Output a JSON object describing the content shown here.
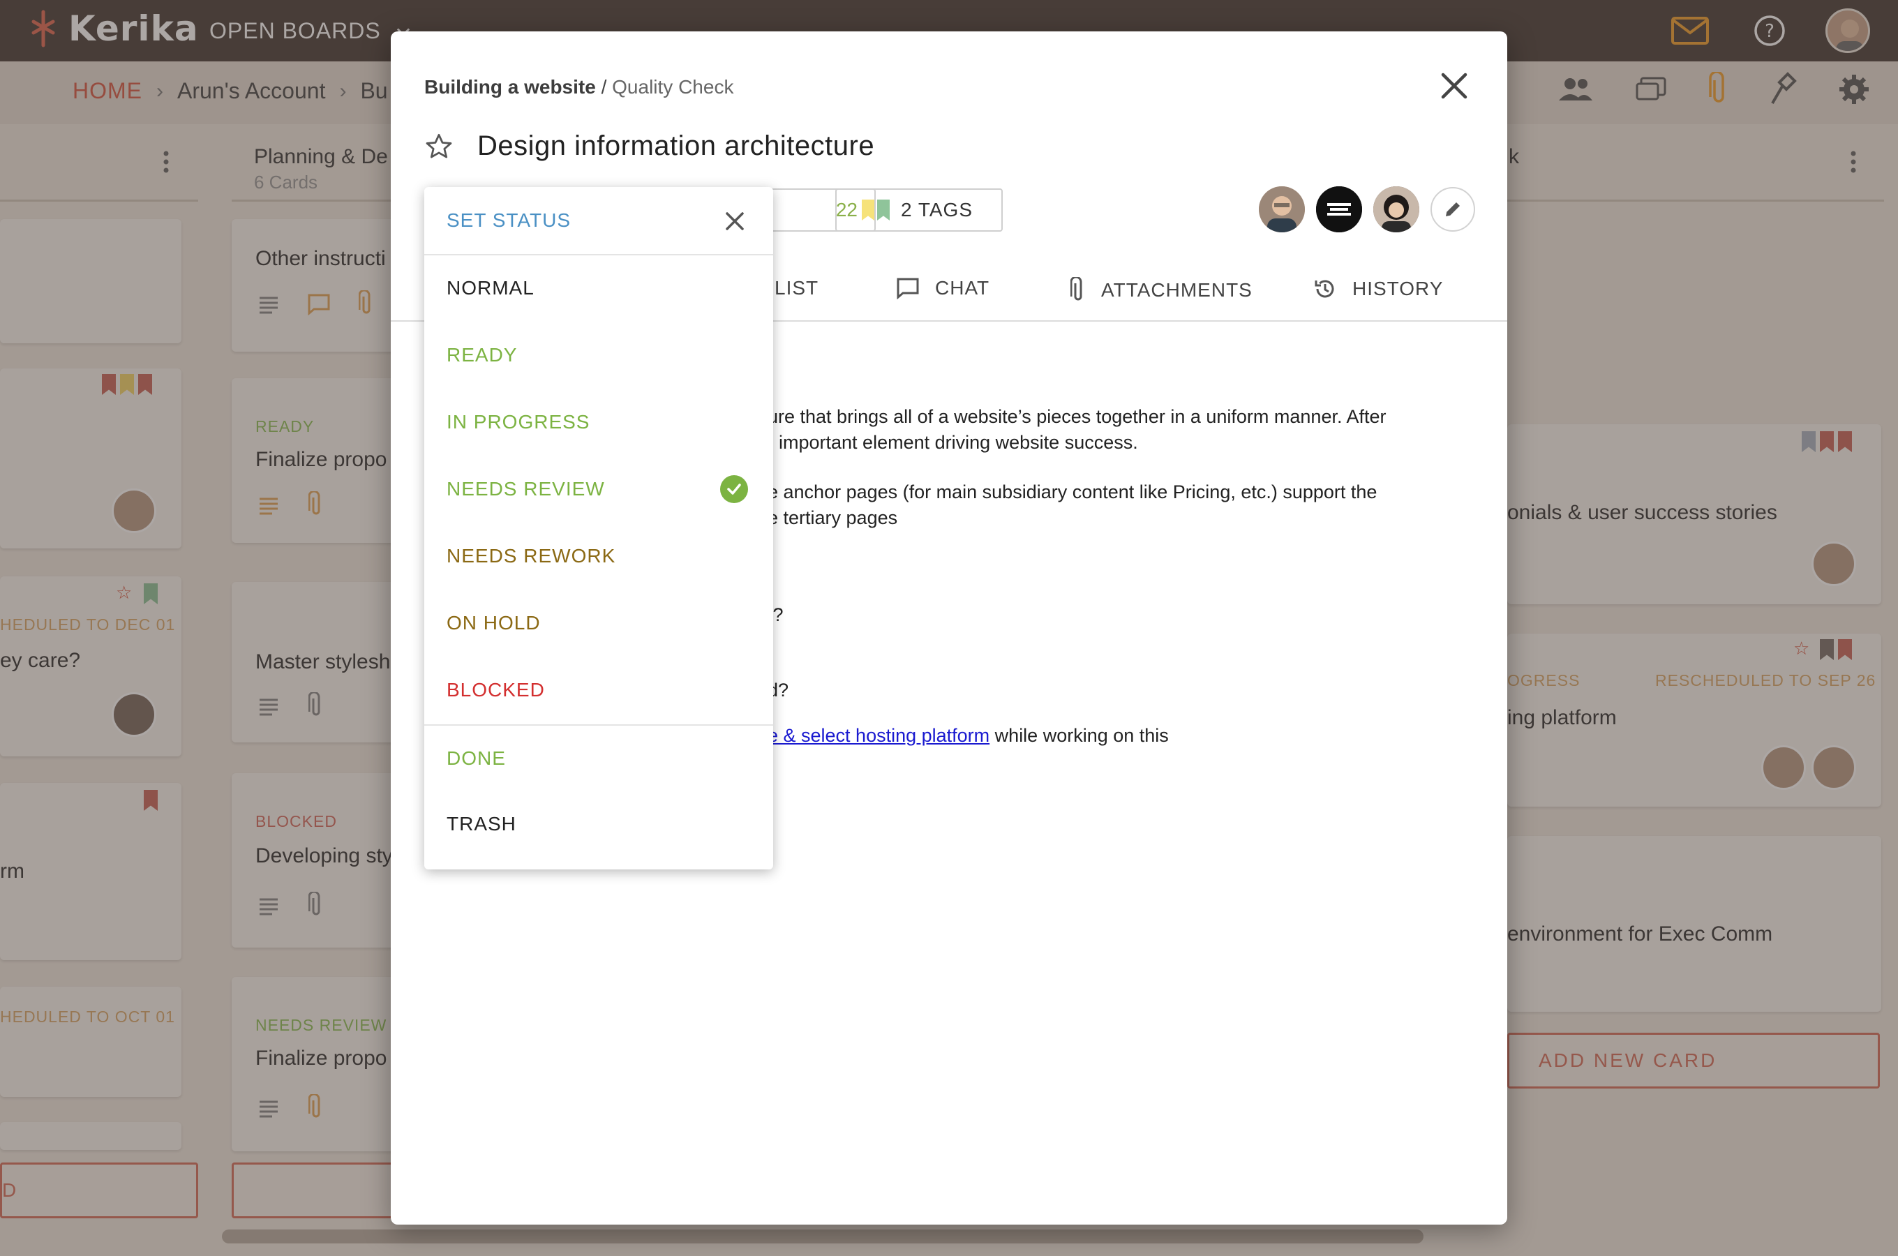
{
  "app": {
    "logo": "Kerika",
    "open_boards": "OPEN BOARDS",
    "breadcrumb": {
      "home": "HOME",
      "account": "Arun's Account",
      "board_partial": "Bu"
    }
  },
  "board": {
    "columns": [
      {
        "title": "Planning & De",
        "count": "6 Cards"
      },
      {
        "title": "k",
        "count": ""
      }
    ],
    "left_cards": [
      {
        "status": "",
        "text": ""
      },
      {
        "status": "HEDULED TO DEC 01",
        "text": "ey care?"
      },
      {
        "status": "",
        "text": "rm"
      },
      {
        "status": "HEDULED TO OCT 01",
        "text": ""
      }
    ],
    "mid_cards": [
      {
        "status": "",
        "text": "Other instructi"
      },
      {
        "status": "READY",
        "text": "Finalize propo"
      },
      {
        "status": "",
        "text": "Master stylesh"
      },
      {
        "status": "BLOCKED",
        "text": "Developing sty"
      },
      {
        "status": "NEEDS REVIEW",
        "text": "Finalize propo"
      }
    ],
    "right_cards": [
      {
        "status": "",
        "status_right": "",
        "text": "onials & user success stories"
      },
      {
        "status": "OGRESS",
        "status_right": "RESCHEDULED TO SEP 26",
        "text": "ing platform"
      },
      {
        "status": "",
        "status_right": "",
        "text": "environment for Exec Comm"
      }
    ],
    "add_left": "D",
    "add_right": "ADD NEW CARD"
  },
  "modal": {
    "crumb_board": "Building a website",
    "crumb_sep": " / ",
    "crumb_column": "Quality Check",
    "title": "Design information architecture",
    "date_partial": "22",
    "tags_label": "2 TAGS",
    "tabs": [
      "LIST",
      "CHAT",
      "ATTACHMENTS",
      "HISTORY"
    ],
    "body": {
      "p1_line1": "ure that brings all of a website’s pieces together in a uniform manner. After",
      "p1_line2": "important element driving website success.",
      "p2_line1": "e anchor pages (for main subsidiary content like Pricing, etc.) support the",
      "p2_line2": "e tertiary pages",
      "q1": "/?",
      "q2": "d?",
      "link_text": "e & select hosting platform",
      "link_suffix": " while working on this"
    }
  },
  "status_menu": {
    "header": "SET STATUS",
    "items": [
      {
        "label": "NORMAL",
        "color": "#222222"
      },
      {
        "label": "READY",
        "color": "#7cb342"
      },
      {
        "label": "IN PROGRESS",
        "color": "#7cb342"
      },
      {
        "label": "NEEDS REVIEW",
        "color": "#7cb342",
        "selected": true
      },
      {
        "label": "NEEDS REWORK",
        "color": "#8b6914"
      },
      {
        "label": "ON HOLD",
        "color": "#8b6914"
      },
      {
        "label": "BLOCKED",
        "color": "#d32f2f"
      },
      {
        "label": "DONE",
        "color": "#7cb342"
      },
      {
        "label": "TRASH",
        "color": "#222222"
      }
    ]
  },
  "colors": {
    "accent": "#d75a46",
    "link": "#1a1ad0",
    "status_header": "#4a90c4",
    "check": "#7cb342"
  }
}
